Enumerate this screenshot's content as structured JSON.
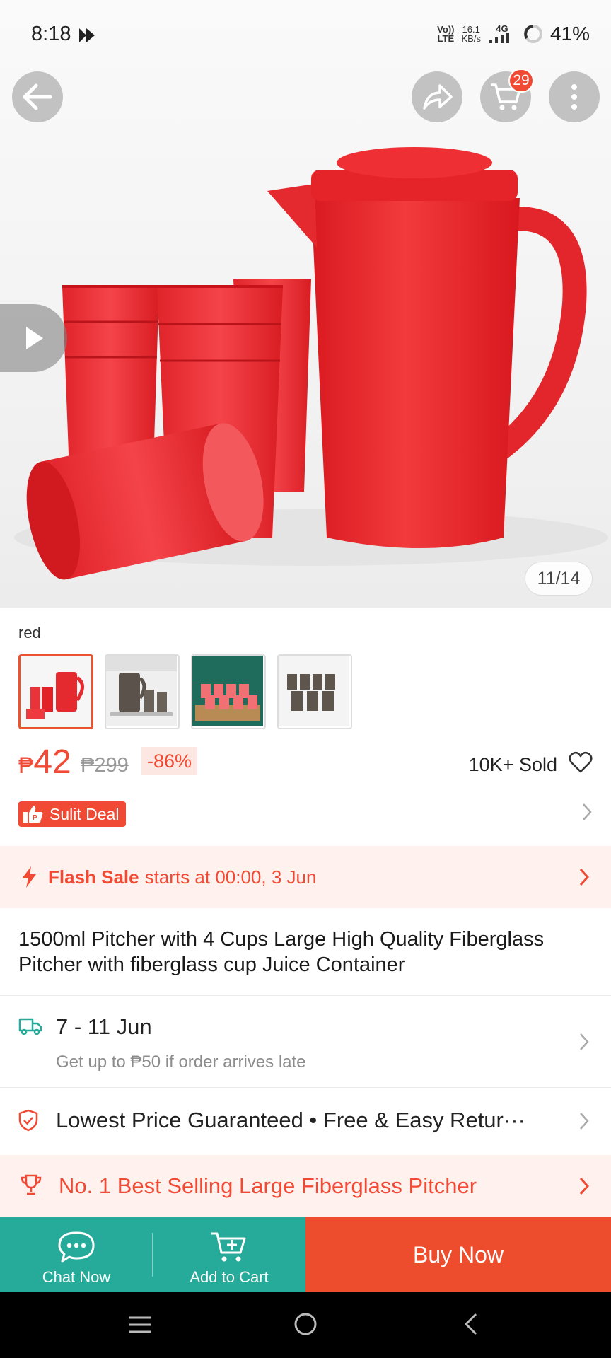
{
  "status_bar": {
    "time": "8:18",
    "volte_line1": "Vo))",
    "volte_line2": "LTE",
    "speed_line1": "16.1",
    "speed_line2": "KB/s",
    "network": "4G",
    "battery": "41%"
  },
  "hero": {
    "cart_count": "29",
    "image_counter": "11/14"
  },
  "variant": {
    "label": "red",
    "thumbnails": [
      "red pitcher set",
      "brown pitcher being poured",
      "red cups on tray",
      "brown cups set"
    ]
  },
  "price": {
    "currency": "₱",
    "current": "42",
    "original": "₱299",
    "discount": "-86%",
    "sold": "10K+ Sold"
  },
  "deal": {
    "label": "Sulit Deal"
  },
  "flash_sale": {
    "title": "Flash Sale",
    "subtitle": "starts at 00:00, 3 Jun"
  },
  "product": {
    "title": "1500ml Pitcher with 4 Cups Large High Quality Fiberglass Pitcher with fiberglass cup Juice Container"
  },
  "delivery": {
    "date": "7 - 11 Jun",
    "note": "Get up to ₱50 if order arrives late"
  },
  "guarantee": {
    "text": "Lowest Price Guaranteed  •  Free & Easy Retur···"
  },
  "bestseller": {
    "text": "No. 1 Best Selling Large Fiberglass Pitcher"
  },
  "bottom_bar": {
    "chat_label": "Chat Now",
    "cart_label": "Add to Cart",
    "buy_label": "Buy Now"
  },
  "colors": {
    "brand": "#ee4d2d",
    "teal": "#26aa99",
    "flash_bg": "#fff1ee"
  }
}
